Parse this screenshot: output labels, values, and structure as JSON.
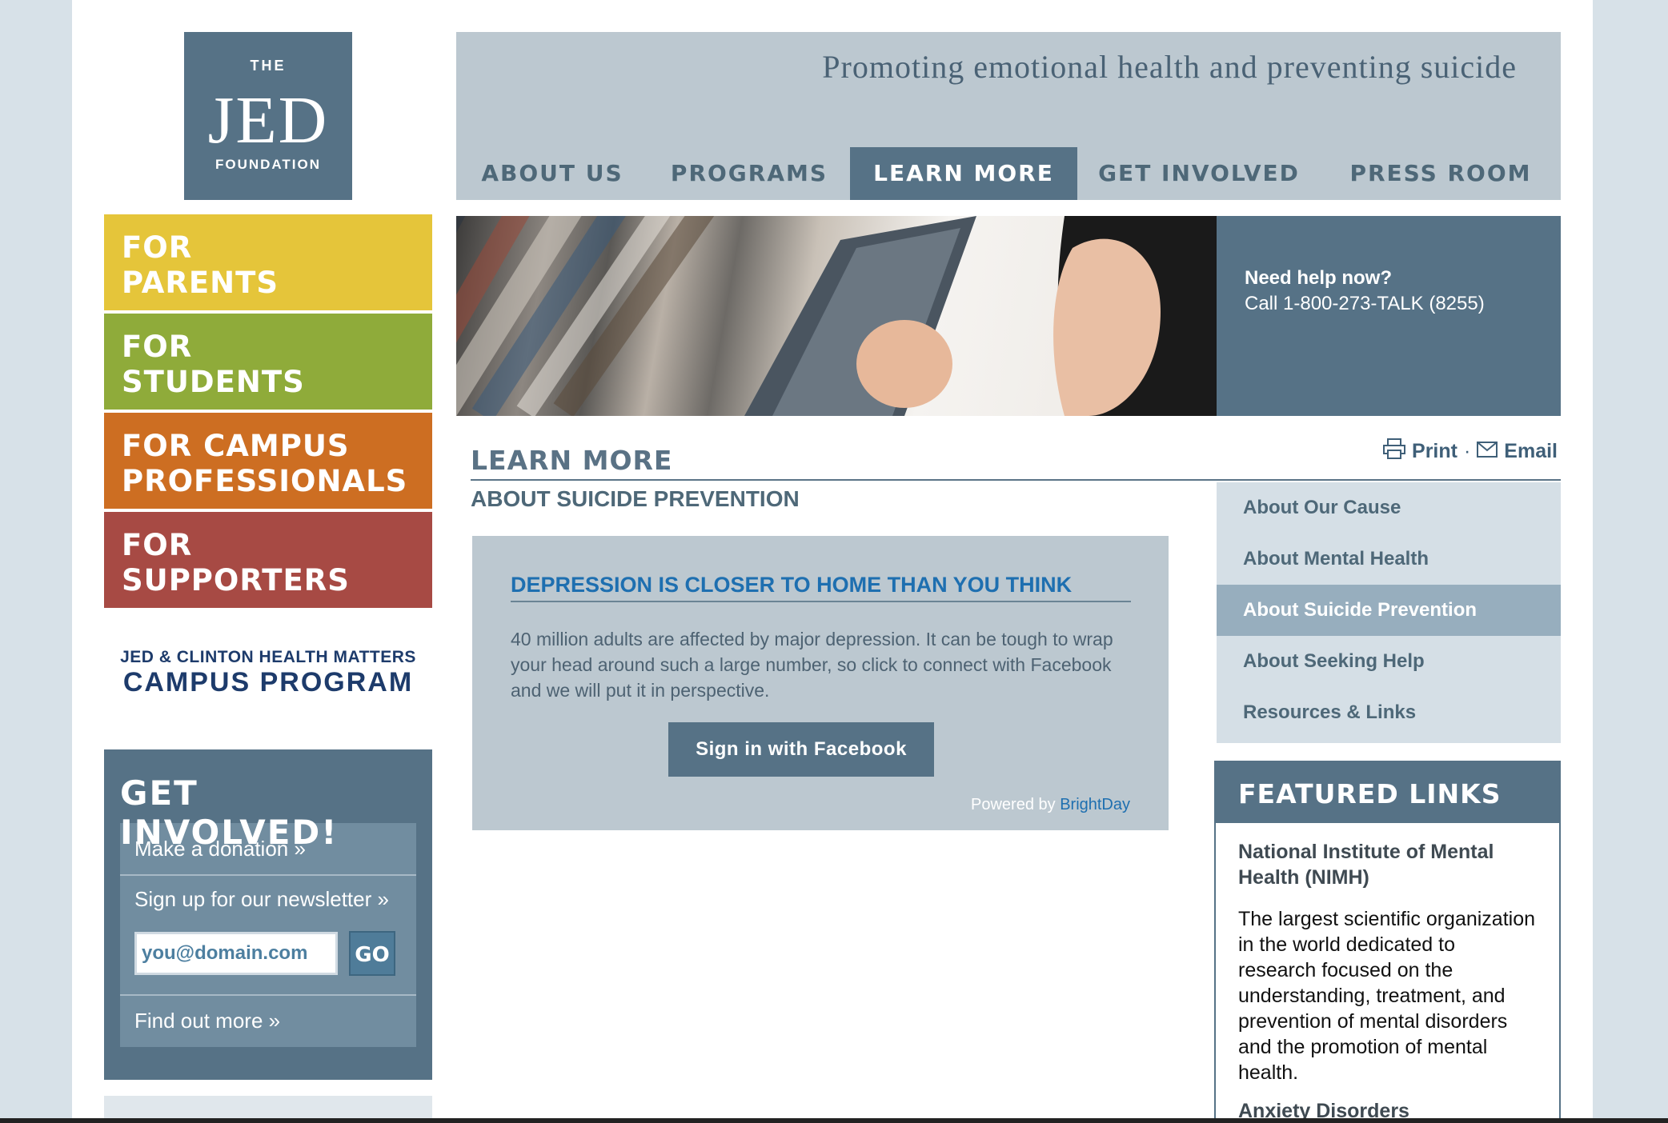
{
  "logo": {
    "the": "THE",
    "jed": "JED",
    "foundation": "FOUNDATION"
  },
  "audience": {
    "parents": "FOR\nPARENTS",
    "students": "FOR\nSTUDENTS",
    "campus": "FOR CAMPUS\nPROFESSIONALS",
    "supporters": "FOR\nSUPPORTERS"
  },
  "campus_program": {
    "line1": "JED & CLINTON HEALTH MATTERS",
    "line2": "CAMPUS PROGRAM"
  },
  "get_involved": {
    "title": "GET INVOLVED!",
    "donation": "Make a donation »",
    "newsletter": "Sign up for our newsletter »",
    "email_value": "you@domain.com",
    "go": "GO",
    "find_out": "Find out more »"
  },
  "header": {
    "tagline": "Promoting emotional health and preventing suicide",
    "nav": [
      "ABOUT US",
      "PROGRAMS",
      "LEARN MORE",
      "GET INVOLVED",
      "PRESS ROOM"
    ],
    "active_nav": "LEARN MORE"
  },
  "help": {
    "question": "Need help now?",
    "phone": "Call 1-800-273-TALK (8255)"
  },
  "page": {
    "section": "LEARN MORE",
    "subtitle": "ABOUT SUICIDE PREVENTION",
    "print": "Print",
    "separator": "·",
    "email": "Email"
  },
  "depression": {
    "title": "DEPRESSION IS CLOSER TO HOME THAN YOU THINK",
    "text": "40 million adults are affected by major depression. It can be tough to wrap your head around such a large number, so click to connect with Facebook and we will put it in perspective.",
    "button": "Sign in with Facebook",
    "powered_by": "Powered by",
    "brightday": "BrightDay"
  },
  "sidenav": {
    "items": [
      "About Our Cause",
      "About Mental Health",
      "About Suicide Prevention",
      "About Seeking Help",
      "Resources & Links"
    ],
    "active": "About Suicide Prevention"
  },
  "featured": {
    "title": "FEATURED LINKS",
    "link1": "National Institute of Mental Health (NIMH)",
    "text1": "The largest scientific organization in the world dedicated to research focused on the understanding, treatment, and prevention of mental disorders and the promotion of mental health.",
    "link2": "Anxiety Disorders"
  },
  "colors": {
    "slate": "#567286",
    "light_slate": "#bcc8d0",
    "yellow": "#e5c53a",
    "green": "#8fab3a",
    "orange": "#cd6e22",
    "red": "#a74a44",
    "link_blue": "#1e6fb0"
  },
  "icons": {
    "print": "printer-icon",
    "email": "envelope-icon"
  }
}
